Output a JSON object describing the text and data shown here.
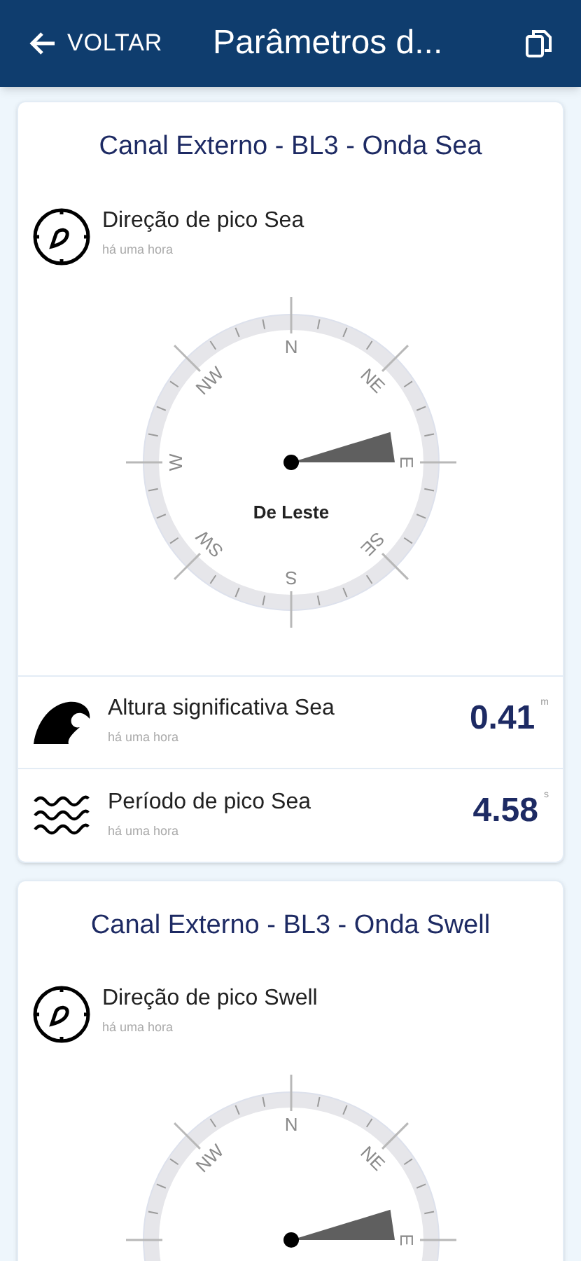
{
  "header": {
    "back": "VOLTAR",
    "title": "Parâmetros d..."
  },
  "cards": [
    {
      "title": "Canal Externo - BL3 - Onda Sea",
      "direction": {
        "label": "Direção de pico Sea",
        "time": "há uma hora",
        "compass": {
          "labels": [
            {
              "text": "N",
              "selected": false
            },
            {
              "text": "NE",
              "selected": false
            },
            {
              "text": "E",
              "selected": true
            },
            {
              "text": "SE",
              "selected": false
            },
            {
              "text": "S",
              "selected": false
            },
            {
              "text": "SW",
              "selected": false
            },
            {
              "text": "W",
              "selected": false
            },
            {
              "text": "NW",
              "selected": false
            }
          ],
          "caption": "De Leste"
        }
      },
      "metrics": [
        {
          "kind": "wave",
          "label": "Altura significativa Sea",
          "time": "há uma hora",
          "value": "0.41",
          "unit": "m"
        },
        {
          "kind": "waves",
          "label": "Período de pico Sea",
          "time": "há uma hora",
          "value": "4.58",
          "unit": "s"
        }
      ]
    },
    {
      "title": "Canal Externo - BL3 - Onda Swell",
      "direction": {
        "label": "Direção de pico Swell",
        "time": "há uma hora",
        "compass": {
          "labels": [
            {
              "text": "N",
              "selected": false
            },
            {
              "text": "NE",
              "selected": false
            },
            {
              "text": "E",
              "selected": true
            },
            {
              "text": "NW",
              "selected": false
            }
          ]
        }
      }
    }
  ]
}
